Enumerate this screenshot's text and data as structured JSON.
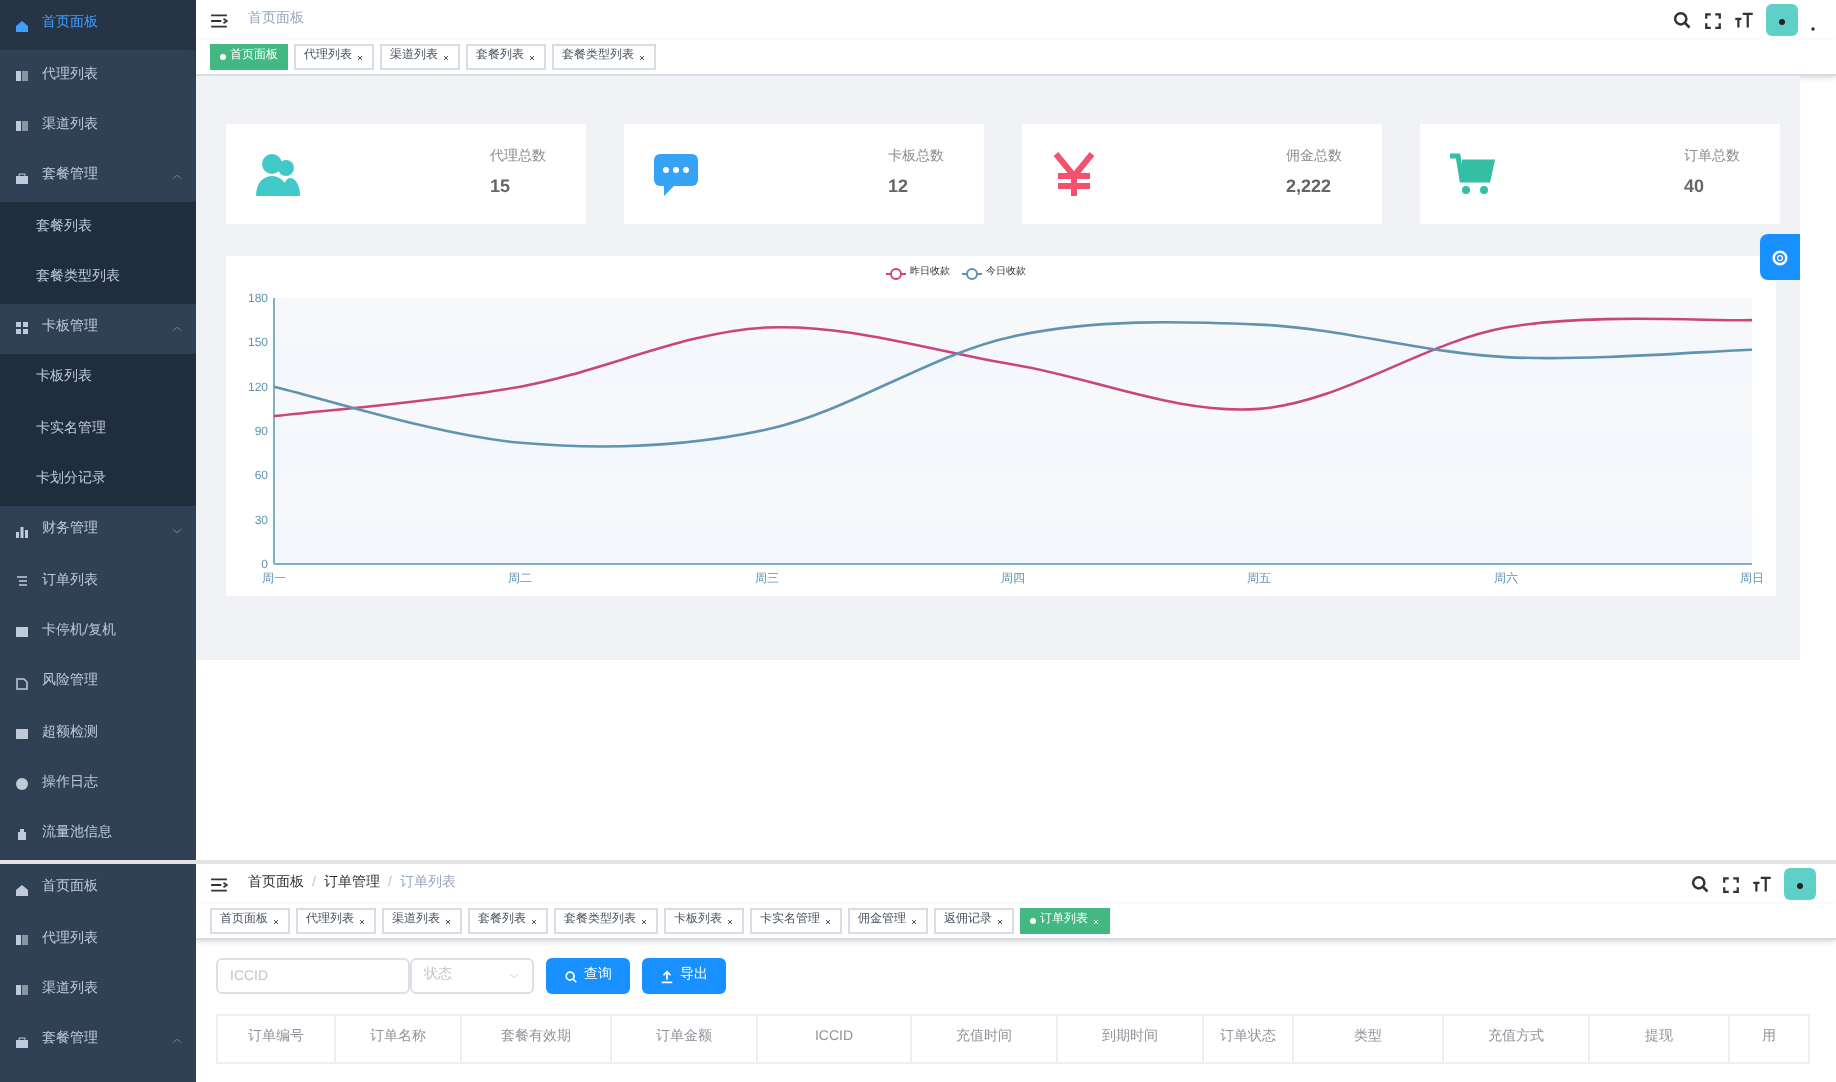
{
  "screens": [
    {
      "sidebar": {
        "items": [
          {
            "label": "首页面板",
            "selected": true
          },
          {
            "label": "代理列表",
            "selected": false
          },
          {
            "label": "渠道列表",
            "selected": false
          },
          {
            "label": "套餐管理",
            "selected": false,
            "expanded": true,
            "children": [
              {
                "label": "套餐列表",
                "selected": false
              },
              {
                "label": "套餐类型列表",
                "selected": false
              }
            ]
          },
          {
            "label": "卡板管理",
            "selected": false,
            "expanded": true,
            "children": [
              {
                "label": "卡板列表",
                "selected": false
              },
              {
                "label": "卡实名管理",
                "selected": false
              },
              {
                "label": "卡划分记录",
                "selected": false
              }
            ]
          },
          {
            "label": "财务管理",
            "selected": false,
            "expanded": false
          },
          {
            "label": "订单列表",
            "selected": false
          },
          {
            "label": "卡停机/复机",
            "selected": false
          },
          {
            "label": "风险管理",
            "selected": false
          },
          {
            "label": "超额检测",
            "selected": false
          },
          {
            "label": "操作日志",
            "selected": false
          },
          {
            "label": "流量池信息",
            "selected": false
          }
        ]
      },
      "breadcrumb": [
        "首页面板"
      ],
      "tags": [
        {
          "label": "首页面板",
          "selected": true
        },
        {
          "label": "代理列表",
          "selected": false
        },
        {
          "label": "渠道列表",
          "selected": false
        },
        {
          "label": "套餐列表",
          "selected": false
        },
        {
          "label": "套餐类型列表",
          "selected": false
        }
      ],
      "stats": [
        {
          "label": "代理总数",
          "value": "15"
        },
        {
          "label": "卡板总数",
          "value": "12"
        },
        {
          "label": "佣金总数",
          "value": "2,222"
        },
        {
          "label": "订单总数",
          "value": "40"
        }
      ],
      "chart_data": {
        "type": "line",
        "legend": "top",
        "categories": [
          "周一",
          "周二",
          "周三",
          "周四",
          "周五",
          "周六",
          "周日"
        ],
        "ylim": [
          0,
          180
        ],
        "yticks": [
          0,
          30,
          60,
          90,
          120,
          150,
          180
        ],
        "series": [
          {
            "name": "昨日收款",
            "color": "#c9457a",
            "values": [
              100,
              120,
              160,
              135,
              105,
              160,
              165
            ]
          },
          {
            "name": "今日收款",
            "color": "#5f93b0",
            "values": [
              120,
              82,
              91,
              154,
              162,
              140,
              145
            ]
          }
        ]
      }
    },
    {
      "sidebar": {
        "items": [
          {
            "label": "首页面板",
            "selected": false
          },
          {
            "label": "代理列表",
            "selected": false
          },
          {
            "label": "渠道列表",
            "selected": false
          },
          {
            "label": "套餐管理",
            "selected": false,
            "expanded": true
          }
        ]
      },
      "breadcrumb": [
        "首页面板",
        "订单管理",
        "订单列表"
      ],
      "breadcrumb_separator": "/",
      "tags": [
        {
          "label": "首页面板",
          "selected": false
        },
        {
          "label": "代理列表",
          "selected": false
        },
        {
          "label": "渠道列表",
          "selected": false
        },
        {
          "label": "套餐列表",
          "selected": false
        },
        {
          "label": "套餐类型列表",
          "selected": false
        },
        {
          "label": "卡板列表",
          "selected": false
        },
        {
          "label": "卡实名管理",
          "selected": false
        },
        {
          "label": "佣金管理",
          "selected": false
        },
        {
          "label": "返佣记录",
          "selected": false
        },
        {
          "label": "订单列表",
          "selected": true
        }
      ],
      "filters": {
        "iccid_placeholder": "ICCID",
        "status_placeholder": "状态",
        "buttons": [
          {
            "kind": "search",
            "label": "查询"
          },
          {
            "kind": "export",
            "label": "导出"
          }
        ]
      },
      "table": {
        "columns": [
          "订单编号",
          "订单名称",
          "套餐有效期",
          "订单金额",
          "ICCID",
          "充值时间",
          "到期时间",
          "订单状态",
          "类型",
          "充值方式",
          "提现",
          "用"
        ]
      }
    }
  ]
}
